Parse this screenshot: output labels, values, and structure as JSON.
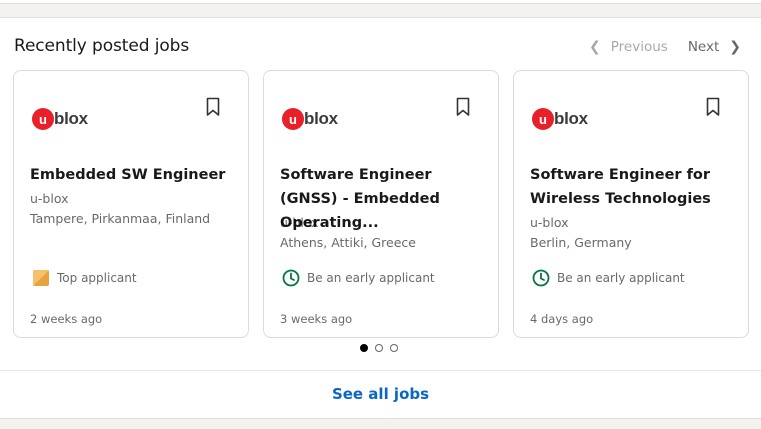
{
  "section": {
    "title": "Recently posted jobs",
    "previous_label": "Previous",
    "next_label": "Next",
    "see_all_label": "See all jobs"
  },
  "pagination": {
    "total_pages": 3,
    "current_page": 1
  },
  "jobs": [
    {
      "logo_mark": "u",
      "logo_text": "blox",
      "title": "Embedded SW Engineer",
      "company": "u-blox",
      "location": "Tampere, Pirkanmaa, Finland",
      "insight": "Top applicant",
      "insight_icon": "top-applicant-icon",
      "posted": "2 weeks ago"
    },
    {
      "logo_mark": "u",
      "logo_text": "blox",
      "title": "Software Engineer (GNSS) - Embedded Operating...",
      "company": "u-blox",
      "location": "Athens, Attiki, Greece",
      "insight": "Be an early applicant",
      "insight_icon": "clock-icon",
      "posted": "3 weeks ago"
    },
    {
      "logo_mark": "u",
      "logo_text": "blox",
      "title": "Software Engineer for Wireless Technologies",
      "company": "u-blox",
      "location": "Berlin, Germany",
      "insight": "Be an early applicant",
      "insight_icon": "clock-icon",
      "posted": "4 days ago"
    }
  ],
  "colors": {
    "brand_red": "#e8202a",
    "link_blue": "#0a66c2",
    "early_green": "#057642",
    "top_applicant_gold": "#e7a33e"
  }
}
